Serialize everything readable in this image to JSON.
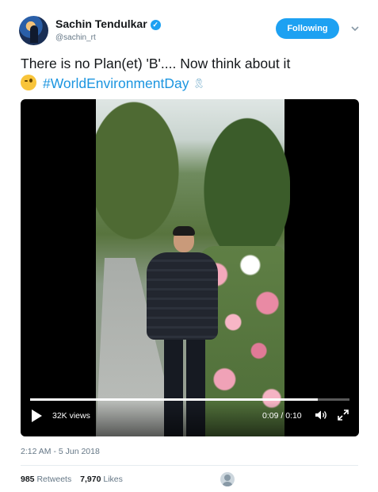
{
  "user": {
    "name": "Sachin Tendulkar",
    "handle": "@sachin_rt",
    "verified_icon": "check-icon",
    "follow_label": "Following"
  },
  "tweet": {
    "text_line": "There is no Plan(et) 'B'.... Now think about it",
    "emoji": "winking-face-emoji",
    "hashtag": "#WorldEnvironmentDay",
    "ribbon_emoji": "ribbon-icon"
  },
  "video": {
    "views": "32K views",
    "time": "0:09 / 0:10",
    "progress_fraction": 0.9
  },
  "meta": {
    "timestamp": "2:12 AM - 5 Jun 2018",
    "retweets_count": "985",
    "retweets_label": "Retweets",
    "likes_count": "7,970",
    "likes_label": "Likes"
  },
  "colors": {
    "accent": "#1da1f2",
    "hashtag": "#1b95e0",
    "muted": "#657786"
  }
}
